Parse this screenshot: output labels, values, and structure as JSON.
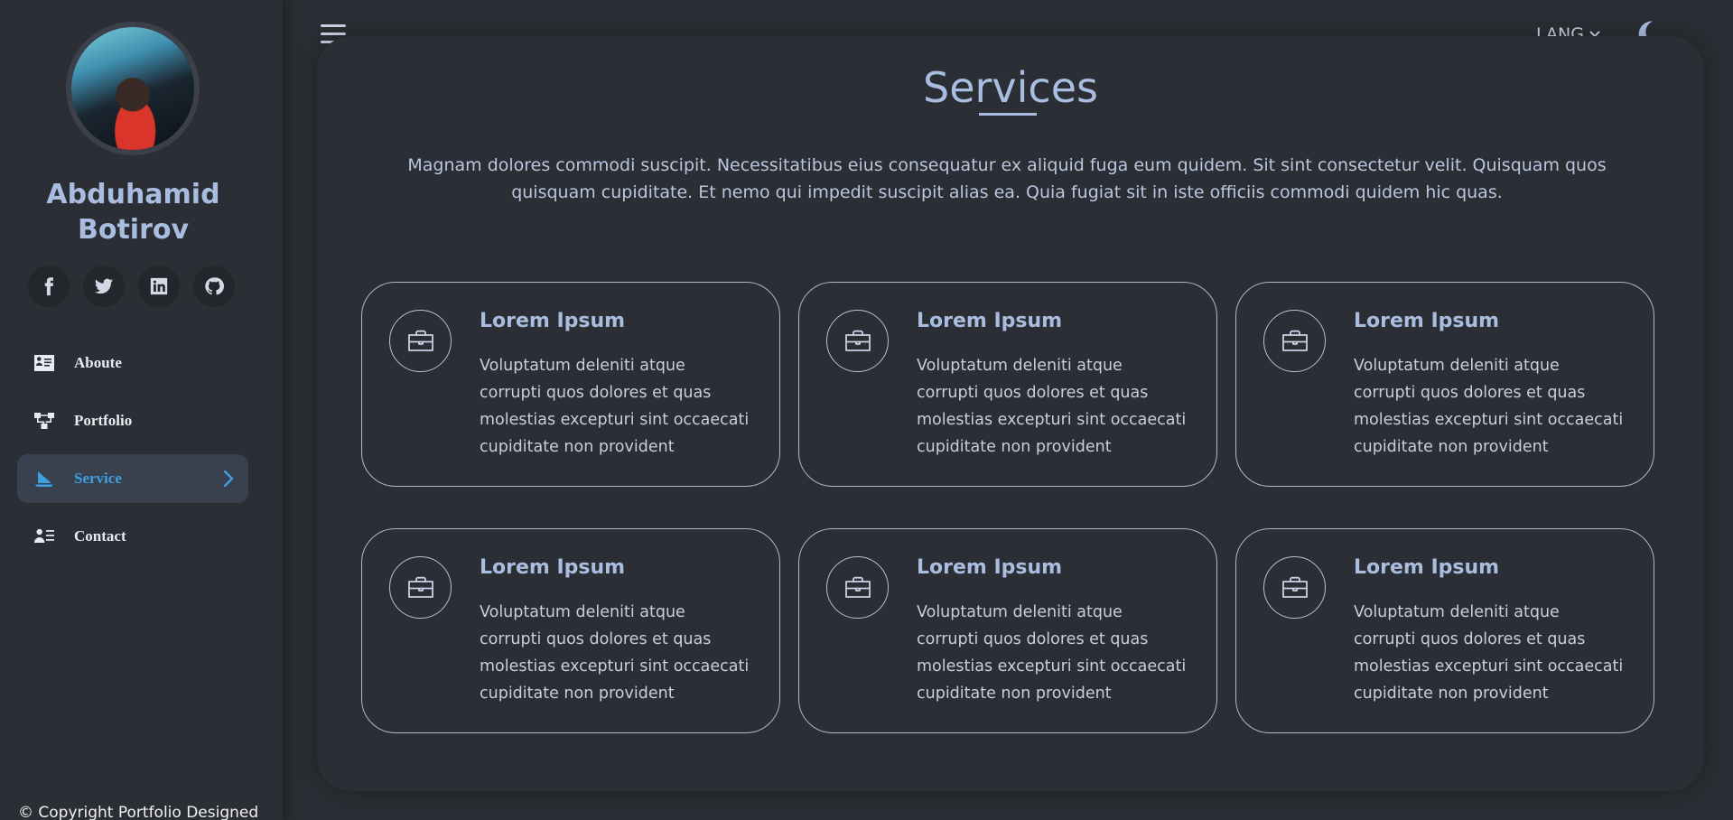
{
  "sidebar": {
    "name": "Abduhamid Botirov",
    "socials": [
      {
        "icon": "facebook-icon"
      },
      {
        "icon": "twitter-icon"
      },
      {
        "icon": "linkedin-icon"
      },
      {
        "icon": "github-icon"
      }
    ],
    "nav": [
      {
        "label": "Aboute",
        "icon": "id-card-icon",
        "active": false
      },
      {
        "label": "Portfolio",
        "icon": "sitemap-icon",
        "active": false
      },
      {
        "label": "Service",
        "icon": "sailboat-icon",
        "active": true
      },
      {
        "label": "Contact",
        "icon": "contact-list-icon",
        "active": false
      }
    ],
    "copyright": "© Copyright Portfolio Designed"
  },
  "topbar": {
    "menu_icon": "hamburger-icon",
    "lang_label": "LANG",
    "theme_icon": "moon-icon"
  },
  "services": {
    "title": "Services",
    "intro": "Magnam dolores commodi suscipit. Necessitatibus eius consequatur ex aliquid fuga eum quidem. Sit sint consectetur velit. Quisquam quos quisquam cupiditate. Et nemo qui impedit suscipit alias ea. Quia fugiat sit in iste officiis commodi quidem hic quas.",
    "cards": [
      {
        "icon": "briefcase-icon",
        "title": "Lorem Ipsum",
        "text": "Voluptatum deleniti atque corrupti quos dolores et quas molestias excepturi sint occaecati cupiditate non provident"
      },
      {
        "icon": "briefcase-icon",
        "title": "Lorem Ipsum",
        "text": "Voluptatum deleniti atque corrupti quos dolores et quas molestias excepturi sint occaecati cupiditate non provident"
      },
      {
        "icon": "briefcase-icon",
        "title": "Lorem Ipsum",
        "text": "Voluptatum deleniti atque corrupti quos dolores et quas molestias excepturi sint occaecati cupiditate non provident"
      },
      {
        "icon": "briefcase-icon",
        "title": "Lorem Ipsum",
        "text": "Voluptatum deleniti atque corrupti quos dolores et quas molestias excepturi sint occaecati cupiditate non provident"
      },
      {
        "icon": "briefcase-icon",
        "title": "Lorem Ipsum",
        "text": "Voluptatum deleniti atque corrupti quos dolores et quas molestias excepturi sint occaecati cupiditate non provident"
      },
      {
        "icon": "briefcase-icon",
        "title": "Lorem Ipsum",
        "text": "Voluptatum deleniti atque corrupti quos dolores et quas molestias excepturi sint occaecati cupiditate non provident"
      }
    ]
  },
  "colors": {
    "background": "#2a2d33",
    "accent": "#3d9fe0",
    "heading": "#a9bde0",
    "active_nav_bg": "#39414f"
  }
}
